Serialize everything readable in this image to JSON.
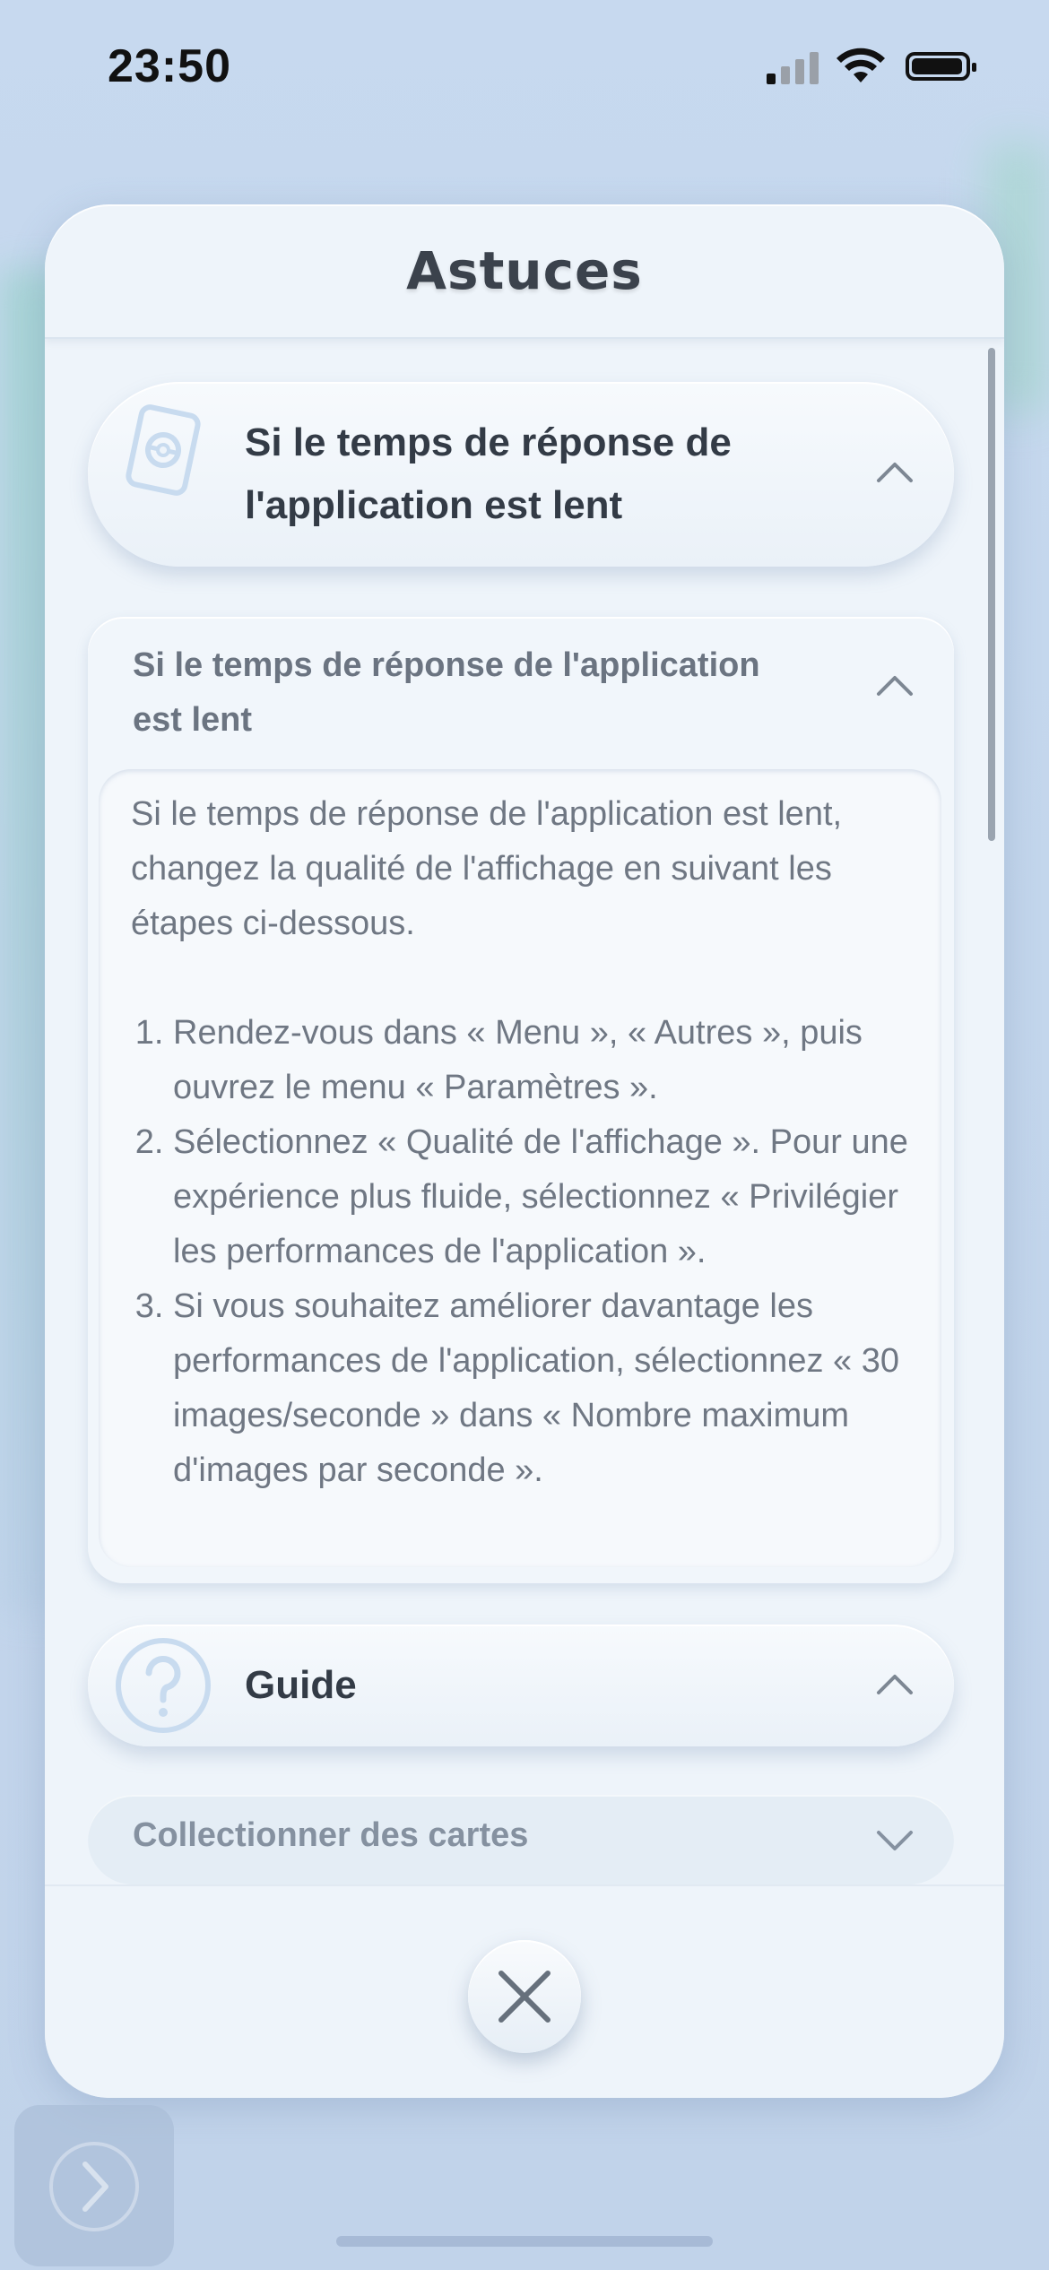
{
  "status_bar": {
    "time": "23:50",
    "signal_bars_active": 1,
    "icons": [
      "signal-icon",
      "wifi-icon",
      "battery-icon"
    ]
  },
  "modal": {
    "title": "Astuces",
    "sections": [
      {
        "label": "Si le temps de réponse de l'application est lent",
        "icon": "card-icon",
        "expanded": true
      },
      {
        "label": "Guide",
        "icon": "question-icon",
        "expanded": true
      }
    ],
    "question": {
      "title": "Si le temps de réponse de l'application est lent",
      "intro": "Si le temps de réponse de l'application est lent, changez la qualité de l'affichage en suivant les étapes ci-dessous.",
      "steps": [
        "Rendez-vous dans « Menu », « Autres », puis ouvrez le menu « Paramètres ».",
        "Sélectionnez « Qualité de l'affichage ». Pour une expérience plus fluide, sélectionnez « Privilégier les performances de l'application ».",
        "Si vous souhaitez améliorer davantage les performances de l'application, sélectionnez « 30 images/seconde » dans « Nombre maximum d'images par seconde »."
      ]
    },
    "guide_item": {
      "label": "Collectionner des cartes"
    },
    "close_icon": "close-icon"
  },
  "side_button_icon": "chevron-right-icon",
  "colors": {
    "accent_blue": "#bcd4ec",
    "text_dark": "#333b46",
    "text_muted": "#6f7783"
  }
}
